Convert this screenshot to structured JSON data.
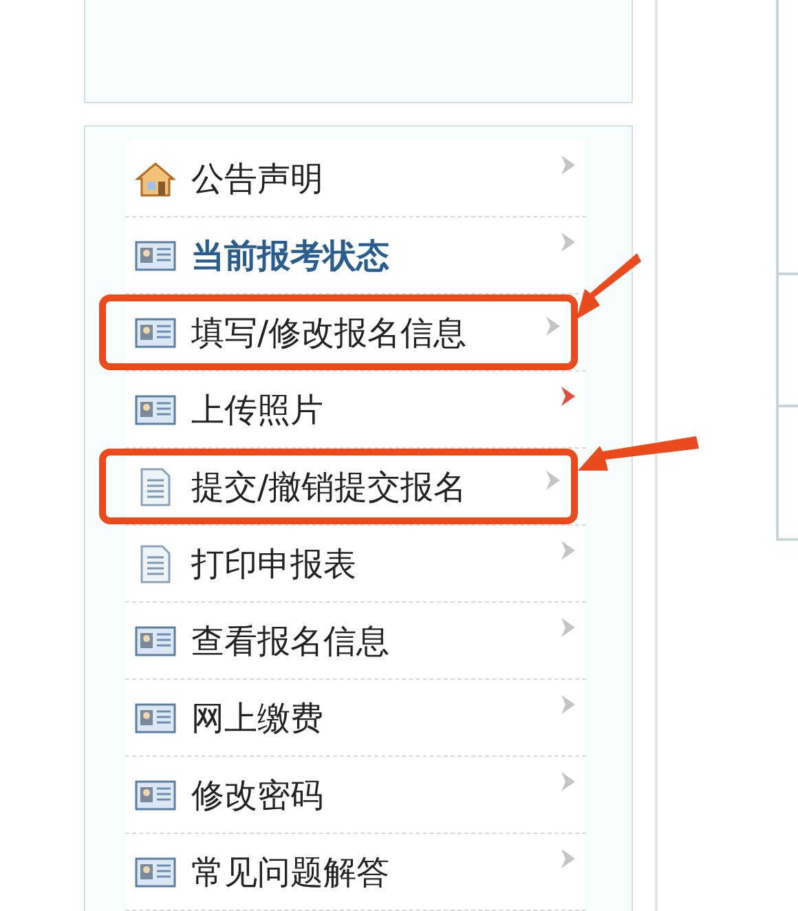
{
  "menu": {
    "items": [
      {
        "label": "公告声明",
        "kind": "home",
        "selected": false,
        "hover": false,
        "annotated": false
      },
      {
        "label": "当前报考状态",
        "kind": "card",
        "selected": true,
        "hover": false,
        "annotated": false
      },
      {
        "label": "填写/修改报名信息",
        "kind": "card",
        "selected": false,
        "hover": false,
        "annotated": true
      },
      {
        "label": "上传照片",
        "kind": "card",
        "selected": false,
        "hover": true,
        "annotated": false
      },
      {
        "label": "提交/撤销提交报名",
        "kind": "doc",
        "selected": false,
        "hover": false,
        "annotated": true
      },
      {
        "label": "打印申报表",
        "kind": "doc",
        "selected": false,
        "hover": false,
        "annotated": false
      },
      {
        "label": "查看报名信息",
        "kind": "card",
        "selected": false,
        "hover": false,
        "annotated": false
      },
      {
        "label": "网上缴费",
        "kind": "card",
        "selected": false,
        "hover": false,
        "annotated": false
      },
      {
        "label": "修改密码",
        "kind": "card",
        "selected": false,
        "hover": false,
        "annotated": false
      },
      {
        "label": "常见问题解答",
        "kind": "card",
        "selected": false,
        "hover": false,
        "annotated": false
      }
    ]
  }
}
